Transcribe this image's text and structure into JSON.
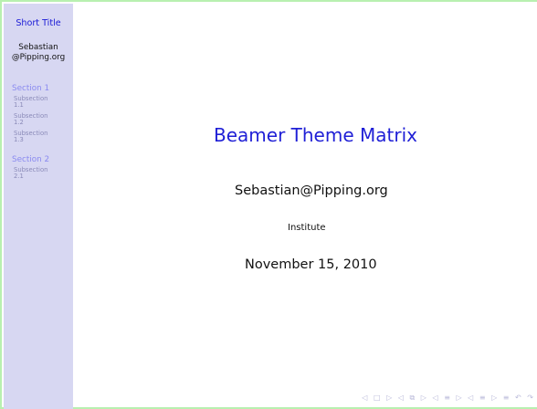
{
  "sidebar": {
    "short_title": "Short Title",
    "author_line_1": "Sebastian",
    "author_line_2": "@Pipping.org",
    "sections": [
      {
        "title": "Section 1",
        "subsections": [
          {
            "line1": "Subsection",
            "line2": "1.1"
          },
          {
            "line1": "Subsection",
            "line2": "1.2"
          },
          {
            "line1": "Subsection",
            "line2": "1.3"
          }
        ]
      },
      {
        "title": "Section 2",
        "subsections": [
          {
            "line1": "Subsection",
            "line2": "2.1"
          }
        ]
      }
    ]
  },
  "main": {
    "title": "Beamer Theme Matrix",
    "author": "Sebastian@Pipping.org",
    "institute": "Institute",
    "date": "November 15, 2010"
  },
  "beamer_nav": {
    "icons": [
      "◁",
      "□",
      "▷",
      "◁",
      "⧉",
      "▷",
      "◁",
      "≡",
      "▷",
      "◁",
      "≡",
      "▷",
      "≡",
      "↶",
      "↷"
    ]
  },
  "colors": {
    "sidebar_bg": "#d7d7f2",
    "accent": "#1f1fd6",
    "page_bg": "#ffffff",
    "outer_bg": "#b8f0b0"
  }
}
